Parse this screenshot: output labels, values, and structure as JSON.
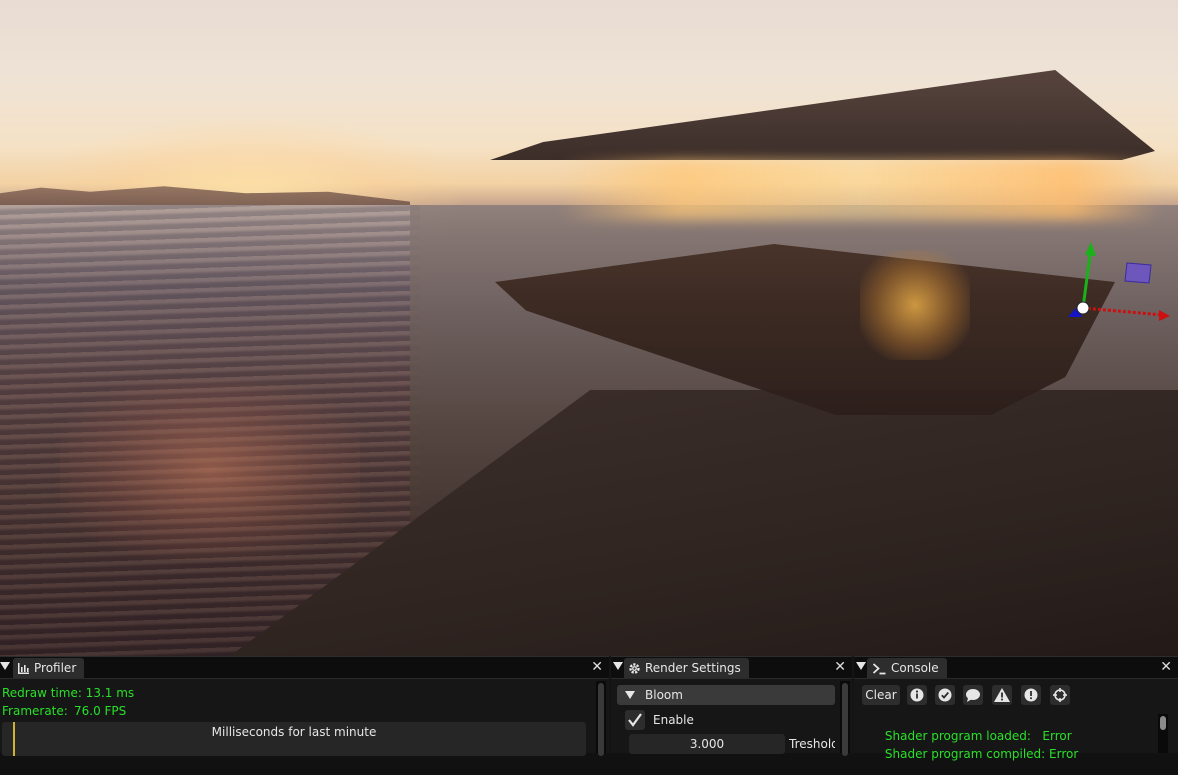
{
  "profiler": {
    "tab_label": "Profiler",
    "redraw_time": "Redraw time: 13.1 ms",
    "framerate_label": "Framerate:",
    "framerate_value": "76.0 FPS",
    "plot_title": "Milliseconds for last minute"
  },
  "render_settings": {
    "tab_label": "Render Settings",
    "section": "Bloom",
    "enable_label": "Enable",
    "threshold_value": "3.000",
    "threshold_label": "Treshold"
  },
  "console": {
    "tab_label": "Console",
    "clear_label": "Clear",
    "filter_icons": [
      "info-icon",
      "check-icon",
      "message-icon",
      "warning-icon",
      "error-icon",
      "crosshair-icon"
    ],
    "lines": [
      {
        "label": "Shader program loaded:",
        "status": "Error"
      },
      {
        "label": "Shader program compiled:",
        "status": "Error"
      }
    ]
  },
  "colors": {
    "log_text": "#29e029",
    "gizmo_x": "#cc1010",
    "gizmo_y": "#19b319",
    "gizmo_z": "#1414c8",
    "plot_cursor": "#d1b22f"
  }
}
